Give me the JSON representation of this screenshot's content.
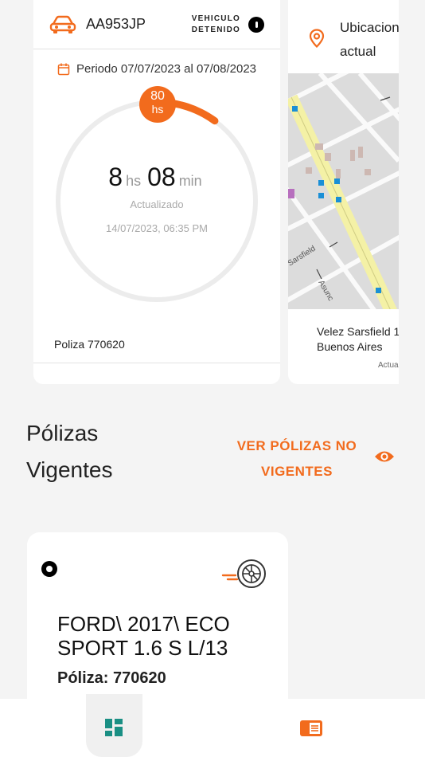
{
  "usage_card": {
    "plate": "AA953JP",
    "status_line1": "VEHICULO",
    "status_line2": "DETENIDO",
    "period": "Periodo 07/07/2023 al 07/08/2023",
    "hours_badge_value": "80",
    "hours_badge_unit": "hs",
    "usage_fraction": 0.1,
    "time_hours": "8",
    "time_hours_unit": "hs",
    "time_minutes": "08",
    "time_minutes_unit": "min",
    "updated_label": "Actualizado",
    "updated_datetime": "14/07/2023, 06:35 PM",
    "policy": "Poliza 770620"
  },
  "location_card": {
    "title": "Ubicacion actual",
    "address_line1": "Velez Sarsfield 1",
    "address_line2": "Buenos Aires",
    "updated_label": "Actua",
    "map_street_1": "Sarsfield",
    "map_street_2": "Asunc"
  },
  "policies_section": {
    "title_line1": "Pólizas",
    "title_line2": "Vigentes",
    "non_vigentes_line1": "VER PÓLIZAS NO",
    "non_vigentes_line2": "VIGENTES"
  },
  "policy_card": {
    "vehicle": "FORD\\ 2017\\ ECO SPORT 1.6 S L/13",
    "policy_number": "Póliza: 770620"
  },
  "colors": {
    "accent": "#f26b1d",
    "map_avenue": "#f4f1a6",
    "map_marker": "#1a8fd6"
  },
  "icons": {
    "header_vehicle": "car-icon",
    "period": "calendar-icon",
    "location": "map-pin-icon",
    "non_vigentes": "eye-icon",
    "policy_type": "tire-icon",
    "nav_home": "dashboard-icon",
    "nav_policies": "policies-book-icon"
  }
}
